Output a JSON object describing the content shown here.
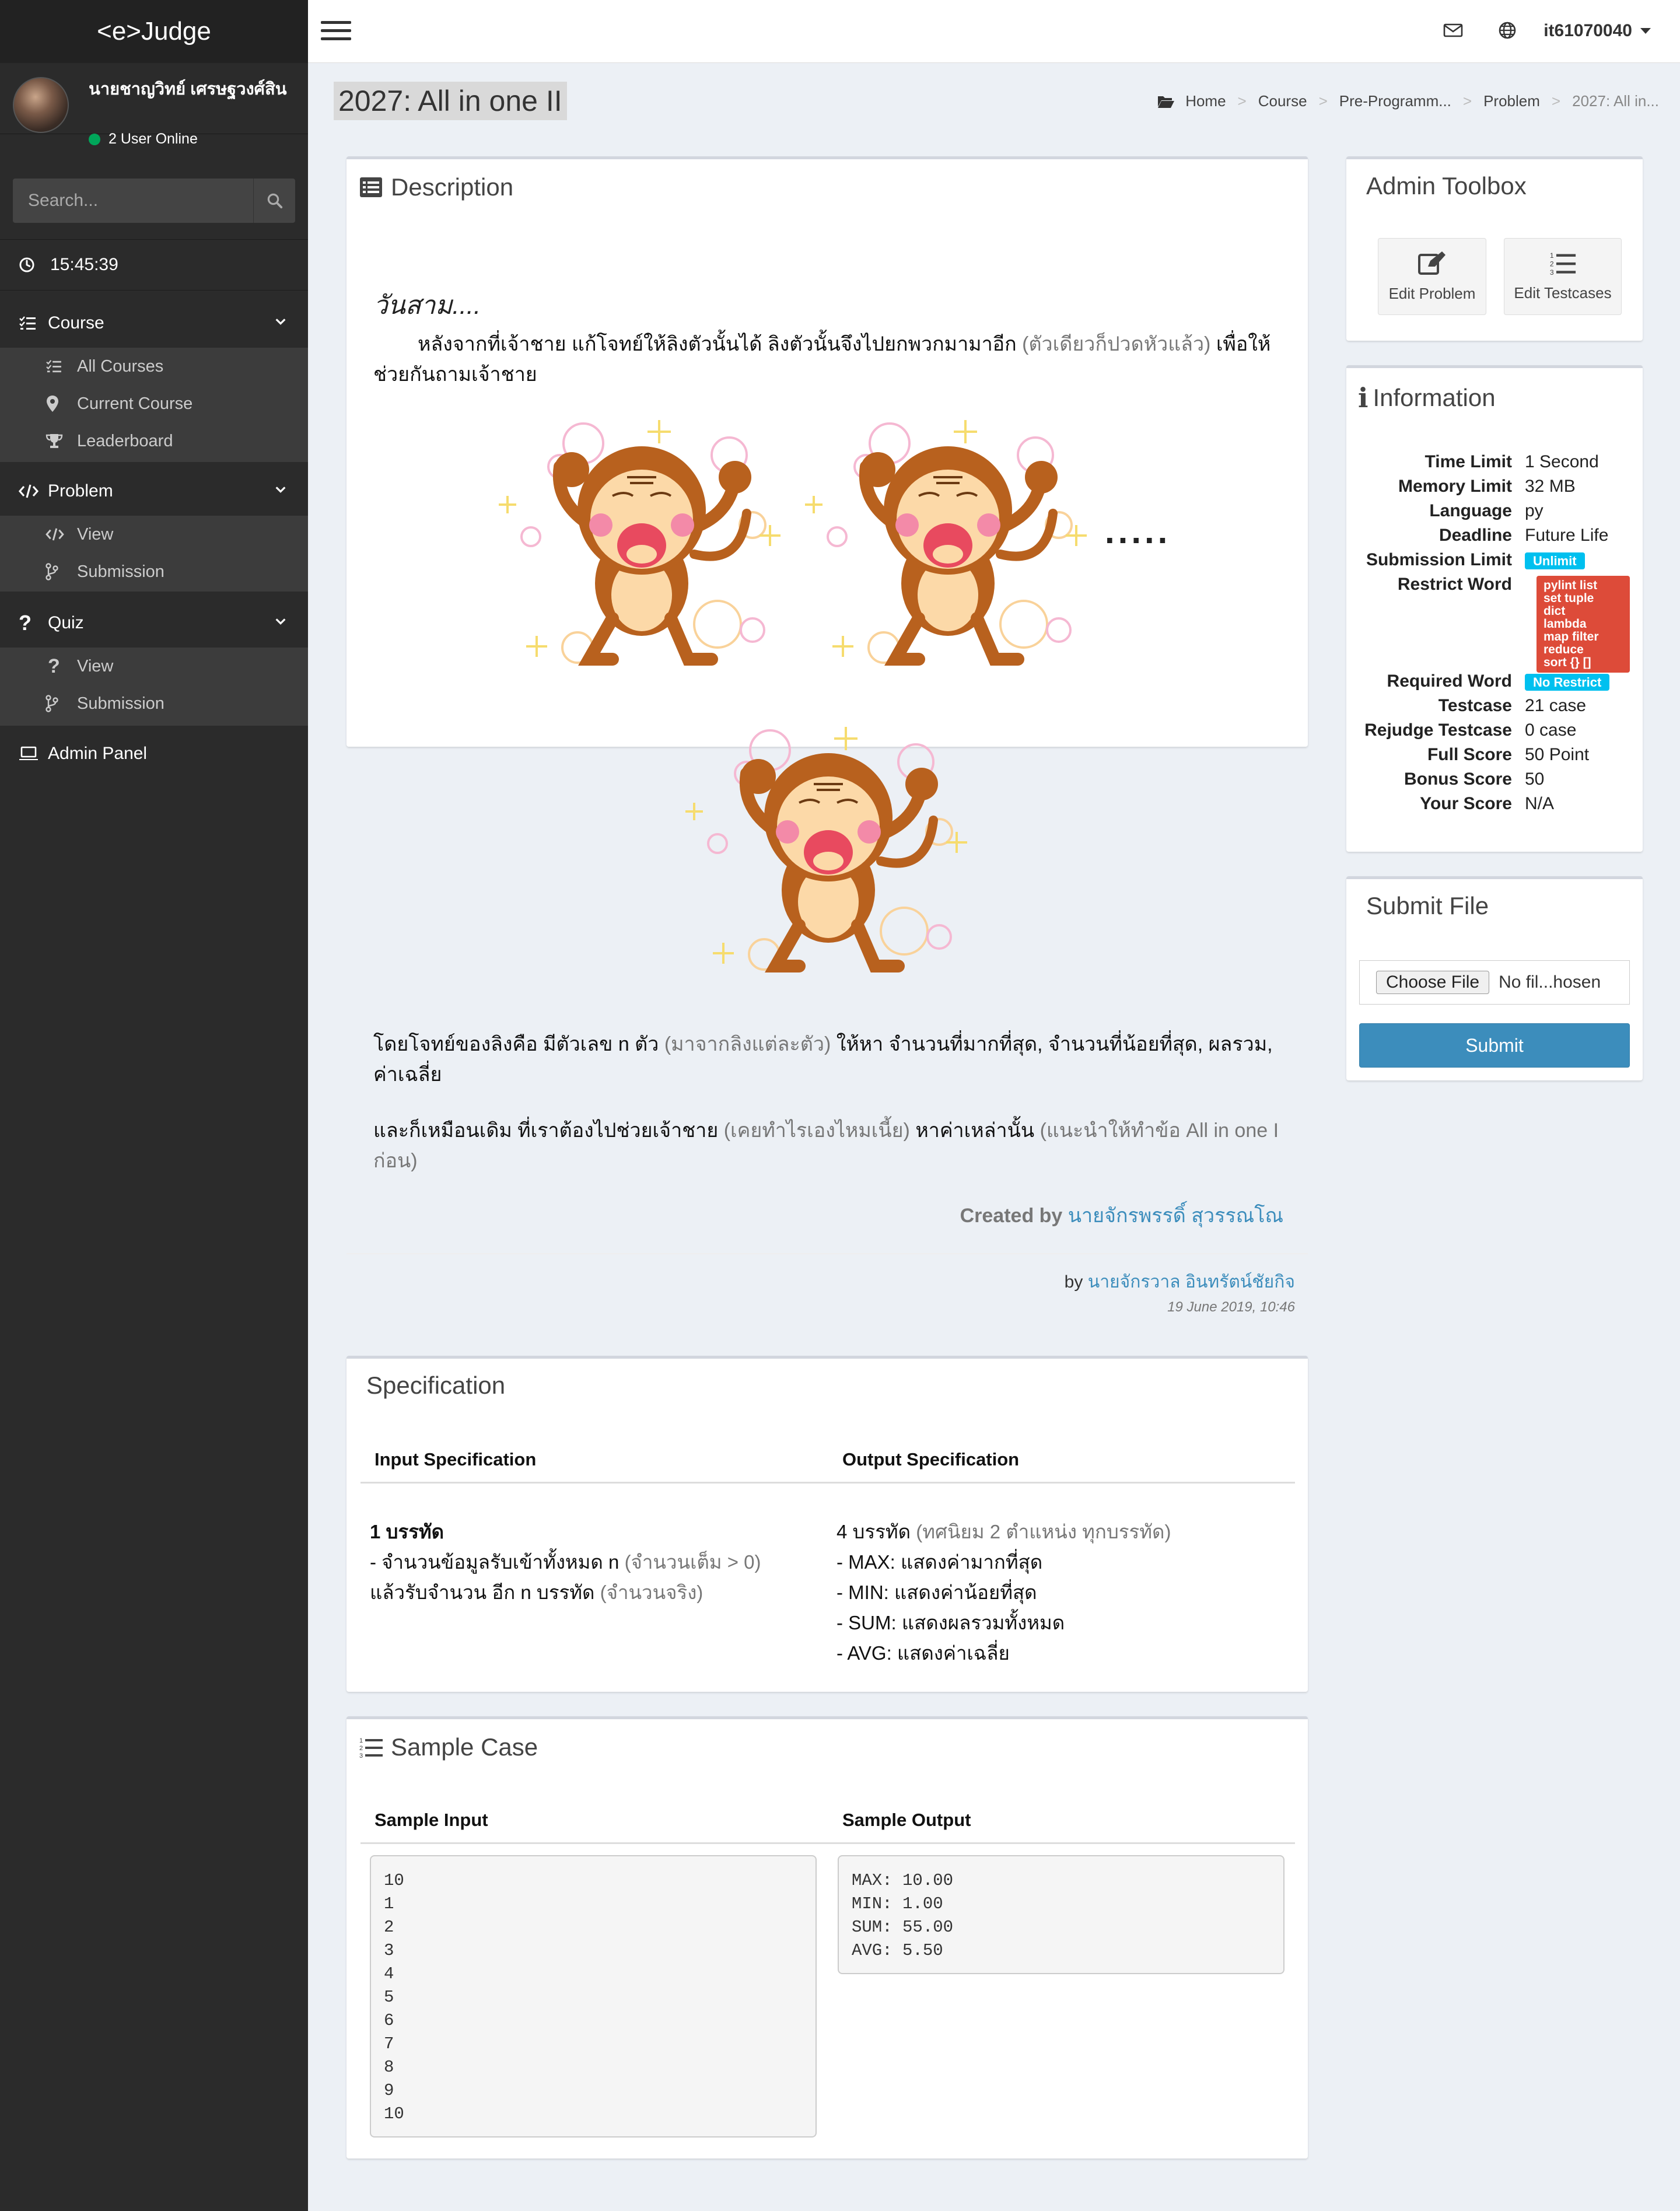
{
  "brand": "<e>Judge",
  "user": {
    "name": "นายชาญวิทย์ เศรษฐวงศ์สิน",
    "online_text": "2 User Online"
  },
  "search": {
    "placeholder": "Search..."
  },
  "clock": "15:45:39",
  "menu": {
    "course": {
      "label": "Course",
      "items": [
        "All Courses",
        "Current Course",
        "Leaderboard"
      ]
    },
    "problem": {
      "label": "Problem",
      "items": [
        "View",
        "Submission"
      ]
    },
    "quiz": {
      "label": "Quiz",
      "items": [
        "View",
        "Submission"
      ]
    },
    "admin": {
      "label": "Admin Panel"
    }
  },
  "topbar": {
    "username": "it61070040"
  },
  "page_title": "2027: All in one II",
  "breadcrumb": [
    "Home",
    "Course",
    "Pre-Programm...",
    "Problem",
    "2027: All in..."
  ],
  "description": {
    "title": "Description",
    "heading": "วันสาม....",
    "para1_a": "หลังจากที่เจ้าชาย แก้โจทย์ให้ลิงตัวนั้นได้ ลิงตัวนั้นจึงไปยกพวกมามาอีก",
    "para1_b": "(ตัวเดียวก็ปวดหัวแล้ว)",
    "para1_c": "เพื่อให้",
    "para1_d": "ช่วยกันถามเจ้าชาย",
    "dots": ".....",
    "para2_a": "โดยโจทย์ของลิงคือ มีตัวเลข n ตัว",
    "para2_b": "(มาจากลิงแต่ละตัว)",
    "para2_c": "ให้หา จำนวนที่มากที่สุด, จำนวนที่น้อยที่สุด, ผลรวม,",
    "para2_d": "ค่าเฉลี่ย",
    "para3_a": "และก็เหมือนเดิม ที่เราต้องไปช่วยเจ้าชาย",
    "para3_b": "(เคยทำไรเองไหมเนี้ย)",
    "para3_c": "หาค่าเหล่านั้น",
    "para3_d": "(แนะนำให้ทำข้อ All in one I",
    "para3_e": "ก่อน)",
    "created_label": "Created by",
    "created_name": "นายจักรพรรดิ์ สุวรรณโณ",
    "by_label": "by",
    "by_name": "นายจักรวาล อินทรัตน์ชัยกิจ",
    "date": "19 June 2019, 10:46"
  },
  "specification": {
    "title": "Specification",
    "input_header": "Input Specification",
    "output_header": "Output Specification",
    "input_lines": [
      {
        "main": "1 บรรทัด",
        "note": ""
      },
      {
        "main": "- จำนวนข้อมูลรับเข้าทั้งหมด n",
        "note": "(จำนวนเต็ม > 0)"
      },
      {
        "main": "แล้วรับจำนวน อีก n บรรทัด",
        "note": "(จำนวนจริง)"
      }
    ],
    "output_lines": [
      {
        "main": "4 บรรทัด",
        "note": "(ทศนิยม 2 ตำแหน่ง ทุกบรรทัด)"
      },
      {
        "main": "- MAX: แสดงค่ามากที่สุด",
        "note": ""
      },
      {
        "main": "- MIN: แสดงค่าน้อยที่สุด",
        "note": ""
      },
      {
        "main": "- SUM: แสดงผลรวมทั้งหมด",
        "note": ""
      },
      {
        "main": "- AVG: แสดงค่าเฉลี่ย",
        "note": ""
      }
    ]
  },
  "sample": {
    "title": "Sample Case",
    "input_header": "Sample Input",
    "output_header": "Sample Output",
    "input": "10\n1\n2\n3\n4\n5\n6\n7\n8\n9\n10",
    "output": "MAX: 10.00\nMIN: 1.00\nSUM: 55.00\nAVG: 5.50"
  },
  "admin_toolbox": {
    "title": "Admin Toolbox",
    "edit_problem": "Edit Problem",
    "edit_testcases": "Edit Testcases"
  },
  "information": {
    "title": "Information",
    "time_limit_label": "Time Limit",
    "time_limit": "1 Second",
    "memory_limit_label": "Memory Limit",
    "memory_limit": "32 MB",
    "language_label": "Language",
    "language": "py",
    "deadline_label": "Deadline",
    "deadline": "Future Life",
    "submission_limit_label": "Submission Limit",
    "submission_limit": "Unlimit",
    "restrict_word_label": "Restrict Word",
    "restrict_words": [
      "pylint list",
      "set tuple",
      "dict",
      "lambda",
      "map filter",
      "reduce",
      "sort {} []"
    ],
    "required_word_label": "Required Word",
    "required_word": "No Restrict",
    "testcase_label": "Testcase",
    "testcase": "21 case",
    "rejudge_label": "Rejudge Testcase",
    "rejudge": "0 case",
    "full_score_label": "Full Score",
    "full_score": "50 Point",
    "bonus_score_label": "Bonus Score",
    "bonus_score": "50",
    "your_score_label": "Your Score",
    "your_score": "N/A"
  },
  "submit_file": {
    "title": "Submit File",
    "choose_label": "Choose File",
    "file_status": "No fil...hosen",
    "submit_label": "Submit"
  },
  "colors": {
    "sidebar": "#2b2b2b",
    "accent": "#3c8dbc",
    "online": "#00a65a",
    "badge_blue": "#00c0ef",
    "badge_red": "#dd4b39"
  }
}
